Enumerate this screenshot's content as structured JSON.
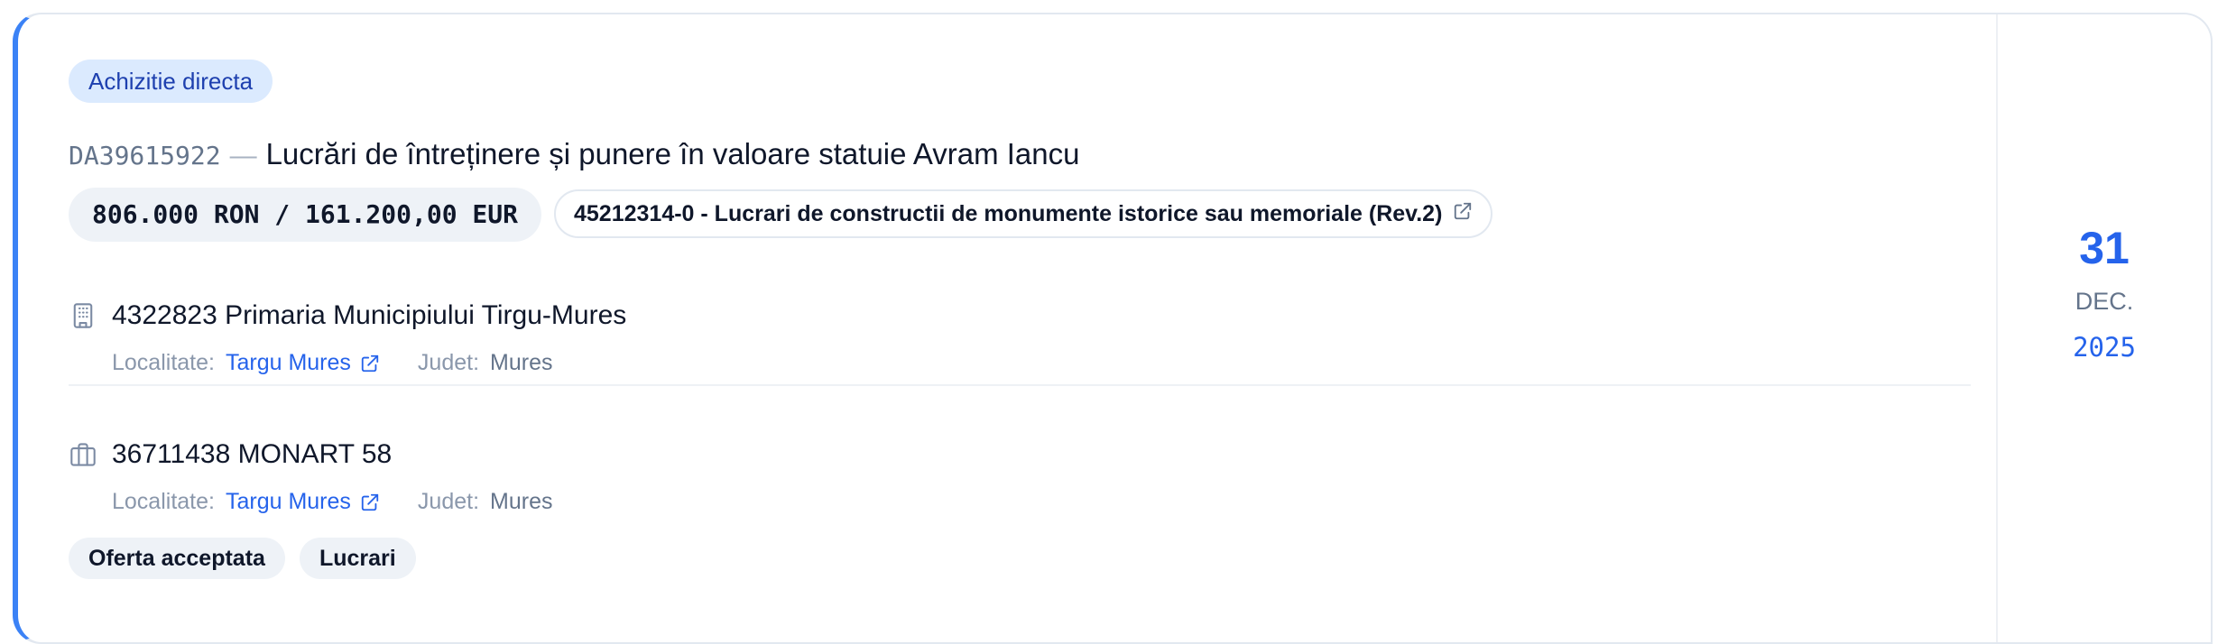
{
  "notice": {
    "type_badge": "Achizitie directa",
    "code": "DA39615922",
    "separator": "—",
    "title": "Lucrări de întreținere și punere în valoare statuie Avram Iancu",
    "value": "806.000 RON / 161.200,00 EUR",
    "cpv": "45212314-0 - Lucrari de constructii de monumente istorice sau memoriale (Rev.2)"
  },
  "authority": {
    "icon": "building-icon",
    "name": "4322823 Primaria Municipiului Tirgu-Mures",
    "locality_label": "Localitate:",
    "locality": "Targu Mures",
    "county_label": "Judet:",
    "county": "Mures"
  },
  "supplier": {
    "icon": "briefcase-icon",
    "name": "36711438 MONART 58",
    "locality_label": "Localitate:",
    "locality": "Targu Mures",
    "county_label": "Judet:",
    "county": "Mures"
  },
  "tags": [
    "Oferta acceptata",
    "Lucrari"
  ],
  "date": {
    "day": "31",
    "month": "DEC.",
    "year": "2025"
  },
  "colors": {
    "accent": "#3b82f6",
    "link": "#2563eb",
    "badge_bg": "#dbeafe",
    "badge_text": "#1e40af"
  }
}
